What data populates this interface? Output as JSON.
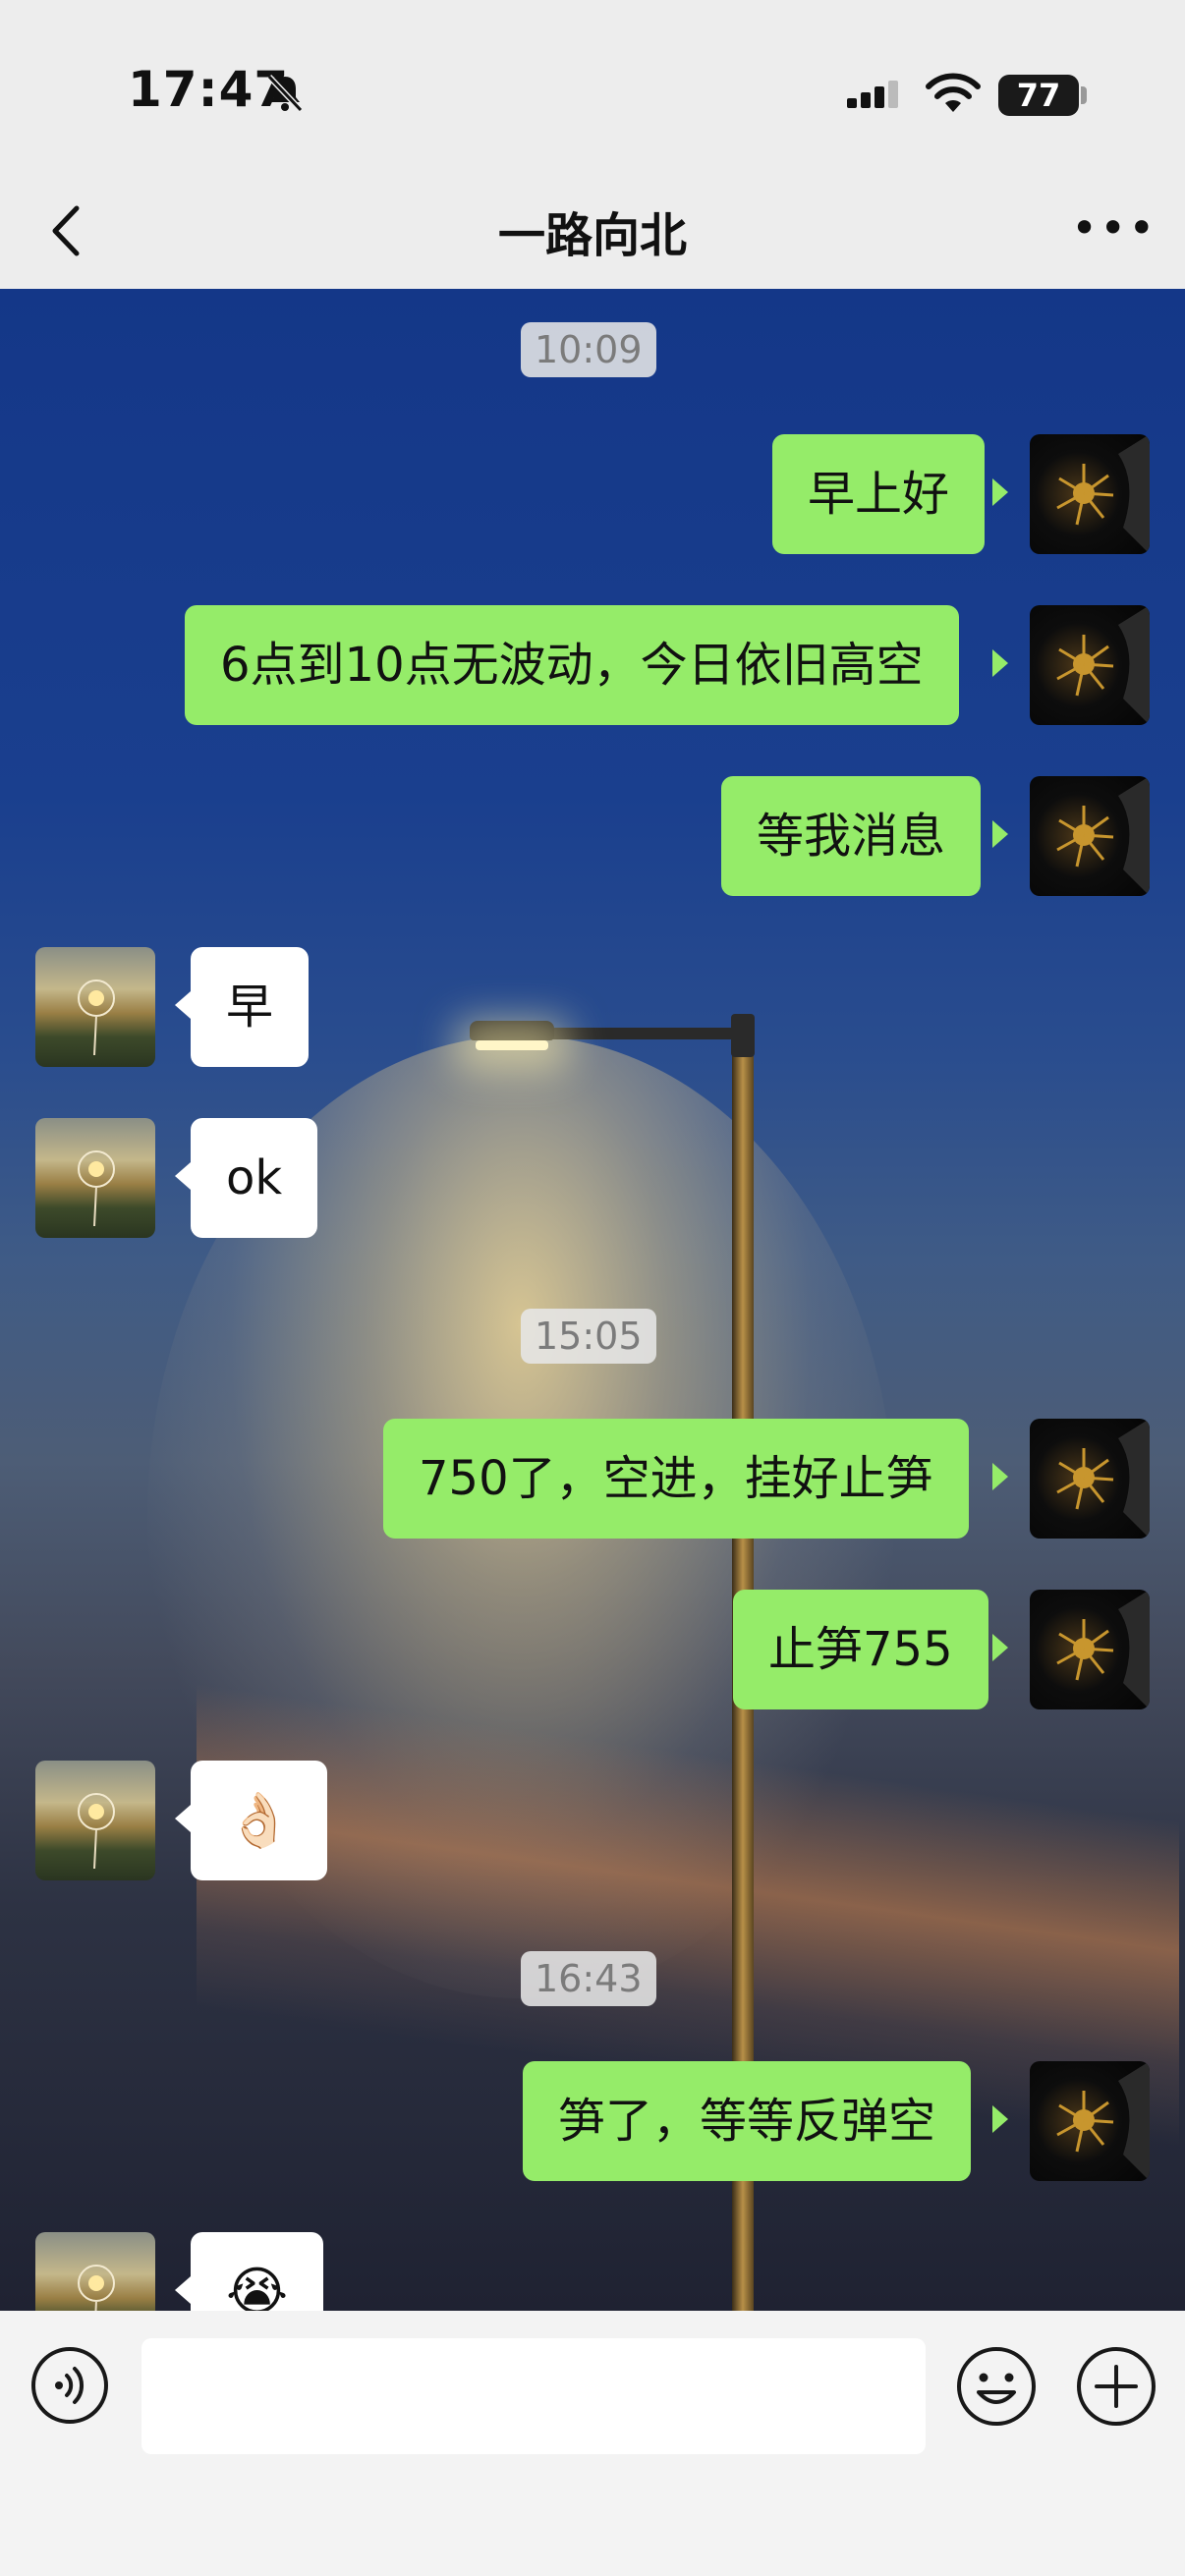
{
  "status_bar": {
    "time": "17:47",
    "battery": "77",
    "icons": [
      "bell-slash-icon",
      "cellular-signal-icon",
      "wifi-icon",
      "battery-icon"
    ]
  },
  "nav": {
    "title": "一路向北",
    "back_icon": "chevron-left-icon",
    "more_icon": "more-dots-icon",
    "more_glyph": "•••"
  },
  "timestamps": [
    "10:09",
    "15:05",
    "16:43"
  ],
  "messages": [
    {
      "side": "self",
      "text": "早上好"
    },
    {
      "side": "self",
      "text": "6点到10点无波动，今日依旧高空"
    },
    {
      "side": "self",
      "text": "等我消息"
    },
    {
      "side": "other",
      "text": "早"
    },
    {
      "side": "other",
      "text": "ok"
    },
    {
      "side": "self",
      "text": "750了，空进，挂好止笋"
    },
    {
      "side": "self",
      "text": "止笋755"
    },
    {
      "side": "other",
      "text": "👌🏻"
    },
    {
      "side": "self",
      "text": "笋了，等等反弹空"
    },
    {
      "side": "other",
      "text": "😭"
    }
  ],
  "input_bar": {
    "placeholder": "",
    "icons": [
      "voice-icon",
      "emoji-icon",
      "plus-icon"
    ]
  },
  "colors": {
    "self_bubble": "#95ec69",
    "other_bubble": "#ffffff",
    "bar_bg": "#ededed"
  }
}
